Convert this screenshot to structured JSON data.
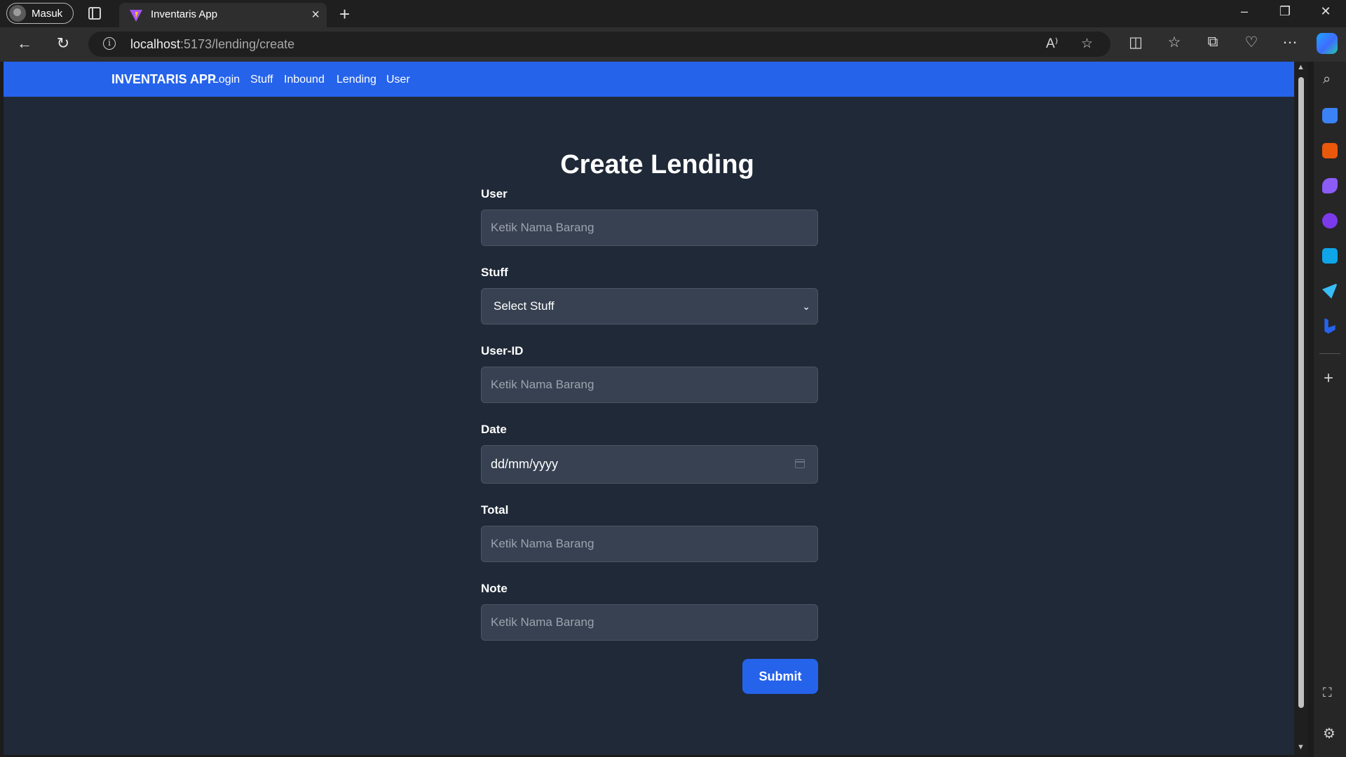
{
  "browser": {
    "profile_label": "Masuk",
    "tab_title": "Inventaris App",
    "url_host": "localhost",
    "url_path": ":5173/lending/create"
  },
  "app": {
    "brand": "INVENTARIS APP",
    "nav": [
      "Login",
      "Stuff",
      "Inbound",
      "Lending",
      "User"
    ]
  },
  "form": {
    "title": "Create Lending",
    "fields": [
      {
        "label": "User",
        "placeholder": "Ketik Nama Barang",
        "type": "text"
      },
      {
        "label": "Stuff",
        "value": "Select Stuff",
        "type": "select"
      },
      {
        "label": "User-ID",
        "placeholder": "Ketik Nama Barang",
        "type": "text"
      },
      {
        "label": "Date",
        "value": "dd/mm/yyyy",
        "type": "date"
      },
      {
        "label": "Total",
        "placeholder": "Ketik Nama Barang",
        "type": "text"
      },
      {
        "label": "Note",
        "placeholder": "Ketik Nama Barang",
        "type": "text"
      }
    ],
    "submit_label": "Submit"
  },
  "colors": {
    "navbar": "#2563eb",
    "page_background": "#1f2937",
    "input_background": "#374151",
    "submit_button": "#2563eb"
  },
  "icons": {
    "sidebar": [
      "search-icon",
      "shopping-tag-icon",
      "toolbox-icon",
      "games-icon",
      "office-icon",
      "outlook-icon",
      "send-icon",
      "bing-icon",
      "add-icon",
      "screenshot-icon",
      "settings-icon"
    ]
  }
}
